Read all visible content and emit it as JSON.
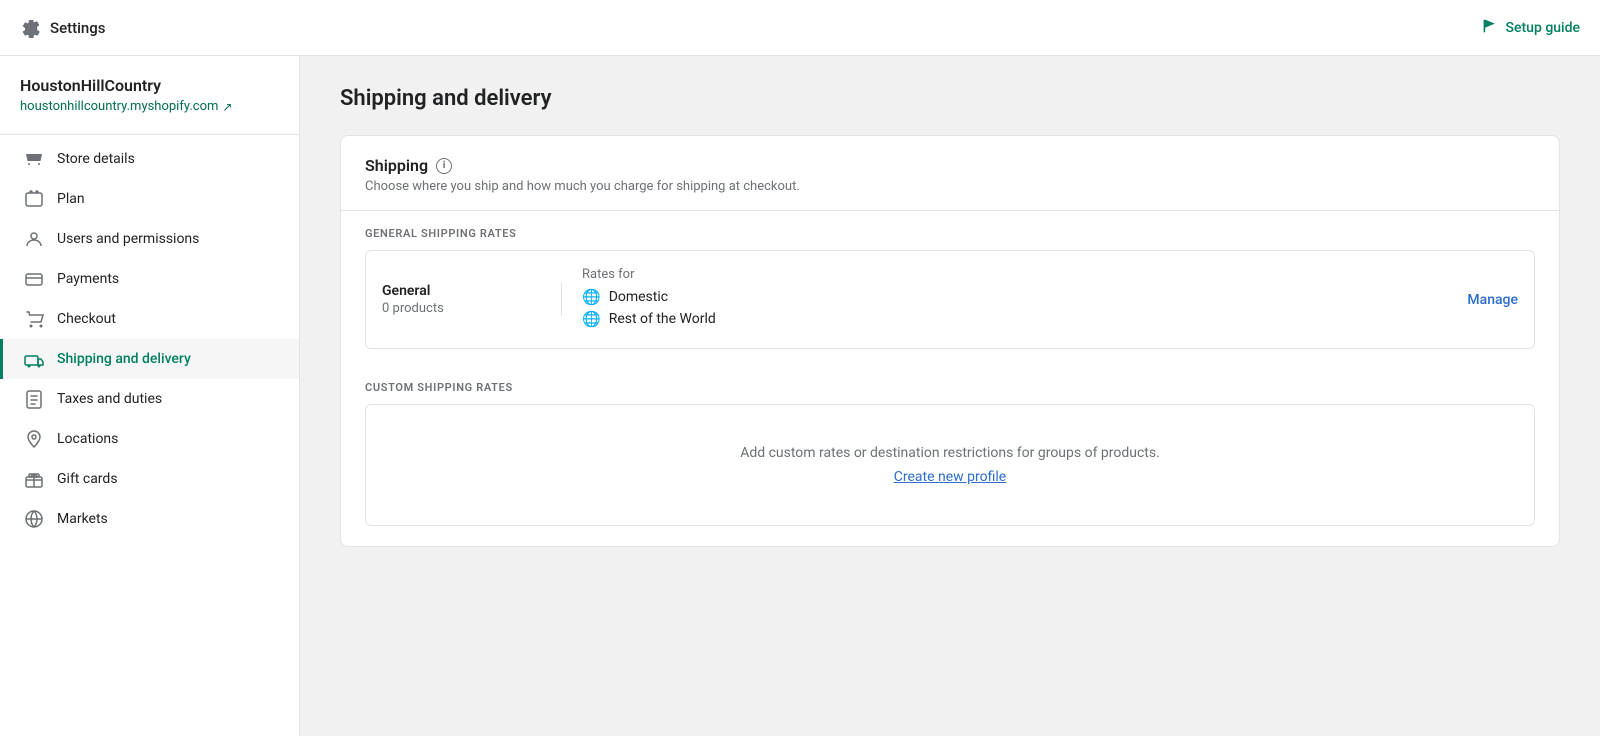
{
  "topbar": {
    "title": "Settings",
    "setup_guide_label": "Setup guide",
    "gear_icon": "⚙"
  },
  "sidebar": {
    "store_name": "HoustonHillCountry",
    "store_url": "houstonhillcountry.myshopify.com",
    "items": [
      {
        "id": "store-details",
        "label": "Store details",
        "icon": "store"
      },
      {
        "id": "plan",
        "label": "Plan",
        "icon": "plan"
      },
      {
        "id": "users-permissions",
        "label": "Users and permissions",
        "icon": "users"
      },
      {
        "id": "payments",
        "label": "Payments",
        "icon": "payments"
      },
      {
        "id": "checkout",
        "label": "Checkout",
        "icon": "checkout"
      },
      {
        "id": "shipping-delivery",
        "label": "Shipping and delivery",
        "icon": "shipping",
        "active": true
      },
      {
        "id": "taxes-duties",
        "label": "Taxes and duties",
        "icon": "taxes"
      },
      {
        "id": "locations",
        "label": "Locations",
        "icon": "locations"
      },
      {
        "id": "gift-cards",
        "label": "Gift cards",
        "icon": "gift"
      },
      {
        "id": "markets",
        "label": "Markets",
        "icon": "markets"
      }
    ]
  },
  "main": {
    "page_title": "Shipping and delivery",
    "shipping_section": {
      "title": "Shipping",
      "card_title": "Shipping",
      "card_description": "Choose where you ship and how much you charge for shipping at checkout.",
      "general_shipping_rates_label": "GENERAL SHIPPING RATES",
      "profile": {
        "name": "General",
        "products_label": "0 products",
        "rates_for_label": "Rates for",
        "rates": [
          "Domestic",
          "Rest of the World"
        ],
        "manage_label": "Manage"
      },
      "custom_shipping_rates_label": "CUSTOM SHIPPING RATES",
      "custom_empty_text": "Add custom rates or destination restrictions for groups of products.",
      "create_profile_label": "Create new profile"
    }
  }
}
